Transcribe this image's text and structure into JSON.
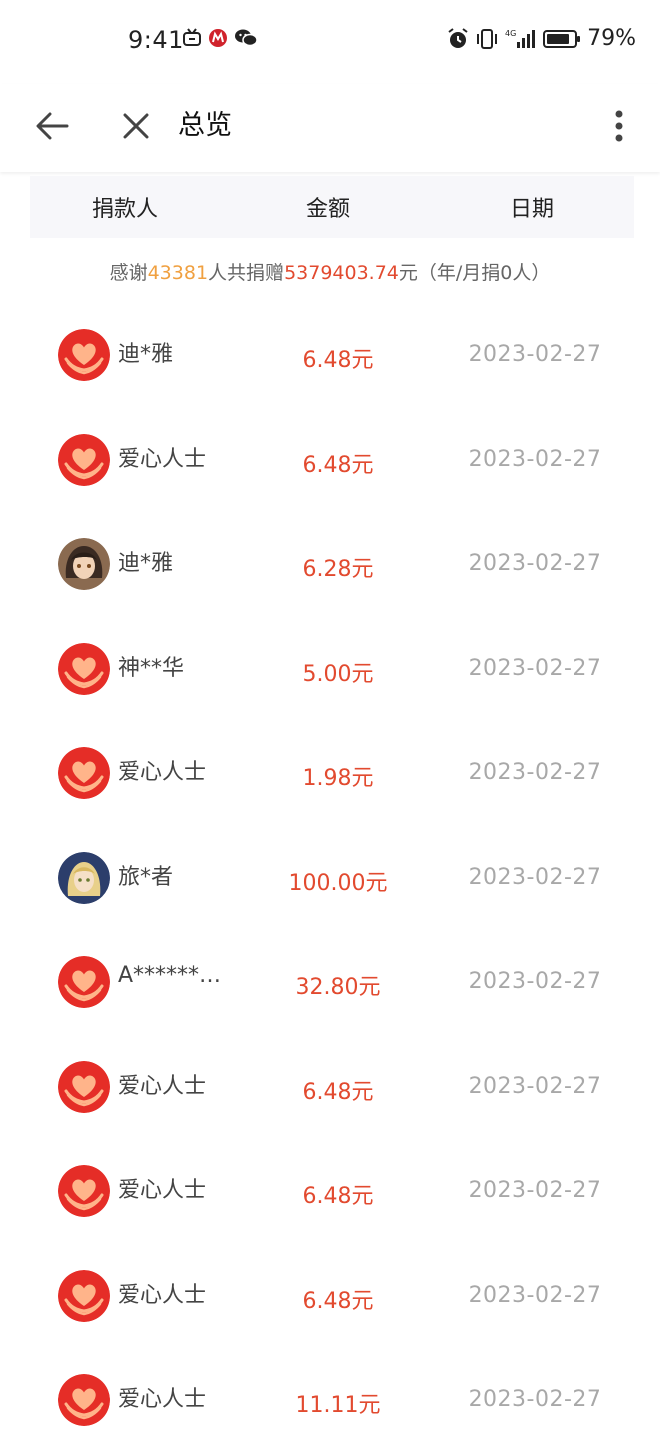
{
  "status_bar": {
    "time": "9:41",
    "battery": "79%"
  },
  "header": {
    "title": "总览"
  },
  "table": {
    "columns": [
      "捐款人",
      "金额",
      "日期"
    ]
  },
  "summary": {
    "prefix": "感谢",
    "count": "43381",
    "middle": "人共捐赠",
    "amount": "5379403.74",
    "suffix": "元（年/月捐0人）"
  },
  "donations": [
    {
      "name": "迪*雅",
      "amount": "6.48元",
      "date": "2023-02-27",
      "avatar": "heart-hands-icon"
    },
    {
      "name": "爱心人士",
      "amount": "6.48元",
      "date": "2023-02-27",
      "avatar": "heart-hands-icon"
    },
    {
      "name": "迪*雅",
      "amount": "6.28元",
      "date": "2023-02-27",
      "avatar": "user-photo-dark"
    },
    {
      "name": "神**华",
      "amount": "5.00元",
      "date": "2023-02-27",
      "avatar": "heart-hands-icon"
    },
    {
      "name": "爱心人士",
      "amount": "1.98元",
      "date": "2023-02-27",
      "avatar": "heart-hands-icon"
    },
    {
      "name": "旅*者",
      "amount": "100.00元",
      "date": "2023-02-27",
      "avatar": "user-photo-blue"
    },
    {
      "name": "A******…",
      "amount": "32.80元",
      "date": "2023-02-27",
      "avatar": "heart-hands-icon"
    },
    {
      "name": "爱心人士",
      "amount": "6.48元",
      "date": "2023-02-27",
      "avatar": "heart-hands-icon"
    },
    {
      "name": "爱心人士",
      "amount": "6.48元",
      "date": "2023-02-27",
      "avatar": "heart-hands-icon"
    },
    {
      "name": "爱心人士",
      "amount": "6.48元",
      "date": "2023-02-27",
      "avatar": "heart-hands-icon"
    },
    {
      "name": "爱心人士",
      "amount": "11.11元",
      "date": "2023-02-27",
      "avatar": "heart-hands-icon"
    }
  ],
  "colors": {
    "amount": "#e24a2f",
    "count_highlight": "#f0a040",
    "date": "#a8a8a8",
    "avatar_red": "#e52d27"
  }
}
